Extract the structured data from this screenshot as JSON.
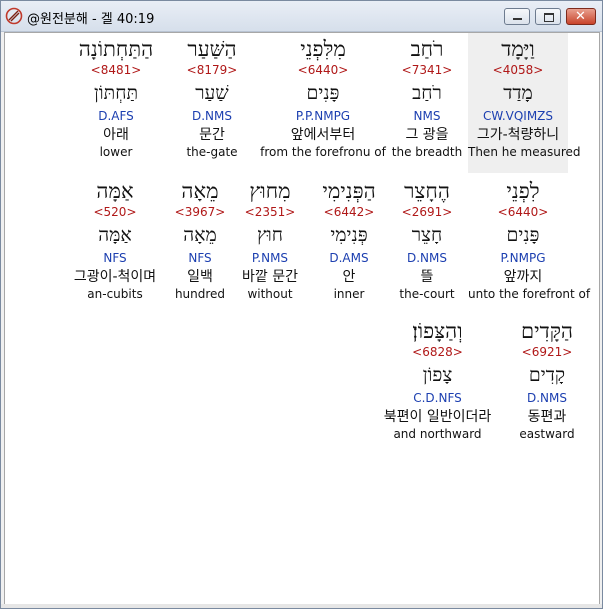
{
  "window": {
    "title": "@원전분해 - 겔 40:19",
    "buttons": {
      "minimize": "minimize",
      "maximize": "maximize",
      "close": "close"
    }
  },
  "rows": [
    [
      {
        "heb": "וַיָּמָד",
        "strong": "<4058>",
        "lemma": "מָדַד",
        "morph": "CW.VQIMZS",
        "kor": "그가-척량하니",
        "eng": "Then he measured",
        "selected": true
      },
      {
        "heb": "רֹחַב",
        "strong": "<7341>",
        "lemma": "רֹחַב",
        "morph": "NMS",
        "kor": "그 광을",
        "eng": "the breadth"
      },
      {
        "heb": "מִלִּפְנֵי",
        "strong": "<6440>",
        "lemma": "פָּנִים",
        "morph": "P.P.NMPG",
        "kor": "앞에서부터",
        "eng": "from the forefronu of"
      },
      {
        "heb": "הַשַּׁעַר",
        "strong": "<8179>",
        "lemma": "שַׁעַר",
        "morph": "D.NMS",
        "kor": "문간",
        "eng": "the-gate"
      },
      {
        "heb": "הַתַּחְתוֹנָה",
        "strong": "<8481>",
        "lemma": "תַּחְתּוֹן",
        "morph": "D.AFS",
        "kor": "아래",
        "eng": "lower"
      }
    ],
    [
      {
        "heb": "לִפְנֵי",
        "strong": "<6440>",
        "lemma": "פָּנִים",
        "morph": "P.NMPG",
        "kor": "앞까지",
        "eng": "unto the forefront of"
      },
      {
        "heb": "הֶחָצֵר",
        "strong": "<2691>",
        "lemma": "חָצֵר",
        "morph": "D.NMS",
        "kor": "뜰",
        "eng": "the-court"
      },
      {
        "heb": "הַפְּנִימִי",
        "strong": "<6442>",
        "lemma": "פְּנִימִי",
        "morph": "D.AMS",
        "kor": "안",
        "eng": "inner"
      },
      {
        "heb": "מִחוּץ",
        "strong": "<2351>",
        "lemma": "חוּץ",
        "morph": "P.NMS",
        "kor": "바깥 문간",
        "eng": "without"
      },
      {
        "heb": "מֵאָה",
        "strong": "<3967>",
        "lemma": "מֵאָה",
        "morph": "NFS",
        "kor": "일백",
        "eng": "hundred"
      },
      {
        "heb": "אַמָּה",
        "strong": "<520>",
        "lemma": "אַמָּה",
        "morph": "NFS",
        "kor": "그광이-척이며",
        "eng": "an-cubits"
      }
    ],
    [
      {
        "heb": "הַקָּדִים",
        "strong": "<6921>",
        "lemma": "קָדִים",
        "morph": "D.NMS",
        "kor": "동편과",
        "eng": "eastward"
      },
      {
        "heb": "וְהַצָּפוֹן׃",
        "strong": "<6828>",
        "lemma": "צָפוֹן",
        "morph": "C.D.NFS",
        "kor": "북편이 일반이더라",
        "eng": "and northward"
      }
    ]
  ]
}
